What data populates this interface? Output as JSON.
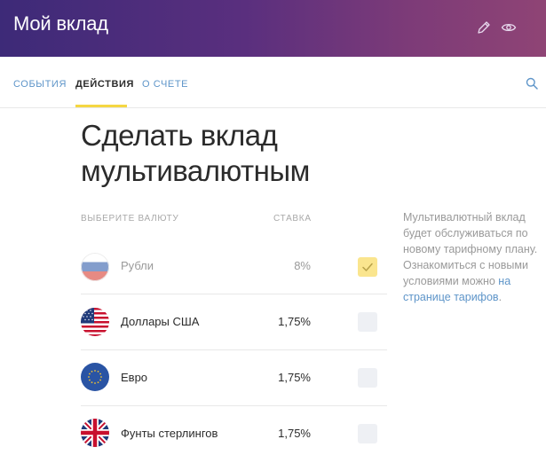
{
  "header": {
    "title": "Мой вклад",
    "icons": [
      "pencil-icon",
      "eye-icon"
    ]
  },
  "tabs": [
    {
      "label": "События",
      "active": false
    },
    {
      "label": "Действия",
      "active": true
    },
    {
      "label": "О счете",
      "active": false
    }
  ],
  "page": {
    "title": "Сделать вклад мультивалютным"
  },
  "table": {
    "col_currency": "Выберите валюту",
    "col_rate": "Ставка",
    "rows": [
      {
        "name": "Рубли",
        "rate": "8%",
        "checked": true,
        "disabled": true,
        "flag": "russia-flag-icon"
      },
      {
        "name": "Доллары США",
        "rate": "1,75%",
        "checked": false,
        "disabled": false,
        "flag": "usa-flag-icon"
      },
      {
        "name": "Евро",
        "rate": "1,75%",
        "checked": false,
        "disabled": false,
        "flag": "eu-flag-icon"
      },
      {
        "name": "Фунты стерлингов",
        "rate": "1,75%",
        "checked": false,
        "disabled": false,
        "flag": "uk-flag-icon"
      }
    ]
  },
  "note": {
    "text": "Мультивалютный вклад будет обслуживаться по новому тарифному плану. Ознакомиться с новыми условиями можно",
    "link": "на странице тарифов",
    "tail": "."
  },
  "colors": {
    "accent": "#5e95c9",
    "tab_underline": "#f5d742",
    "checked_box": "#fae58e",
    "header_start": "#3d2a78",
    "header_end": "#8f4475"
  }
}
